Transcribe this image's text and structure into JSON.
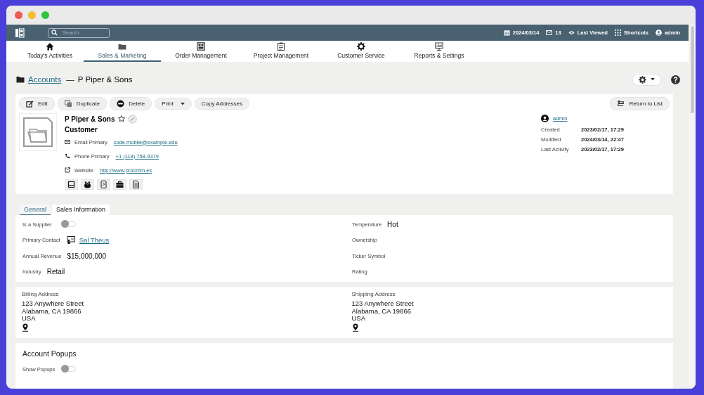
{
  "topbar": {
    "search_placeholder": "Search",
    "date": "2024/03/14",
    "messages": "13",
    "last_viewed": "Last Viewed",
    "shortcuts": "Shortcuts",
    "user": "admin"
  },
  "nav": [
    {
      "label": "Today's Activities",
      "selected": false
    },
    {
      "label": "Sales & Marketing",
      "selected": true
    },
    {
      "label": "Order Management",
      "selected": false
    },
    {
      "label": "Project Management",
      "selected": false
    },
    {
      "label": "Customer Service",
      "selected": false
    },
    {
      "label": "Reports & Settings",
      "selected": false
    }
  ],
  "breadcrumb": {
    "link": "Accounts",
    "separator": "—",
    "title": "P Piper & Sons"
  },
  "toolbar": [
    {
      "label": "Edit",
      "kind": "edit"
    },
    {
      "label": "Duplicate",
      "kind": "duplicate"
    },
    {
      "label": "Delete",
      "kind": "delete"
    },
    {
      "label": "Print",
      "kind": "menu"
    },
    {
      "label": "Copy Addresses",
      "kind": "plain"
    }
  ],
  "return_button": "Return to List",
  "record": {
    "name": "P Piper & Sons",
    "favorite": false,
    "type": "Customer",
    "contacts": [
      {
        "label": "Email Primary",
        "value": "code.mobile@example.edu"
      },
      {
        "label": "Phone Primary",
        "value": "+1 (118) 758-9379"
      },
      {
        "label": "Website",
        "value": "http://www.procrbm.es"
      }
    ]
  },
  "meta": {
    "owner": "admin",
    "rows": [
      {
        "label": "Created",
        "value": "2023/02/17, 17:29"
      },
      {
        "label": "Modified",
        "value": "2024/03/14, 22:47"
      },
      {
        "label": "Last Activity",
        "value": "2023/02/17, 17:29"
      }
    ]
  },
  "tabs": [
    {
      "label": "General",
      "selected": true
    },
    {
      "label": "Sales Information",
      "selected": false
    }
  ],
  "fields_left": [
    {
      "label": "Is a Supplier",
      "kind": "toggle",
      "on": false
    },
    {
      "label": "Primary Contact",
      "kind": "contact",
      "value": "Sal Theus"
    },
    {
      "label": "Annual Revenue",
      "kind": "text",
      "value": "$15,000,000"
    },
    {
      "label": "Industry",
      "kind": "text",
      "value": "Retail"
    }
  ],
  "fields_right": [
    {
      "label": "Temperature",
      "kind": "text",
      "value": "Hot"
    },
    {
      "label": "Ownership",
      "kind": "text"
    },
    {
      "label": "Ticker Symbol",
      "kind": "text"
    },
    {
      "label": "Rating",
      "kind": "text"
    }
  ],
  "addresses": [
    {
      "label": "Billing Address",
      "lines": [
        "123 Anywhere Street",
        "Alabama, CA 19866",
        "USA"
      ]
    },
    {
      "label": "Shipping Address",
      "lines": [
        "123 Anywhere Street",
        "Alabama, CA 19866",
        "USA"
      ]
    }
  ],
  "popups": {
    "title": "Account Popups",
    "label": "Show Popups",
    "on": false
  }
}
